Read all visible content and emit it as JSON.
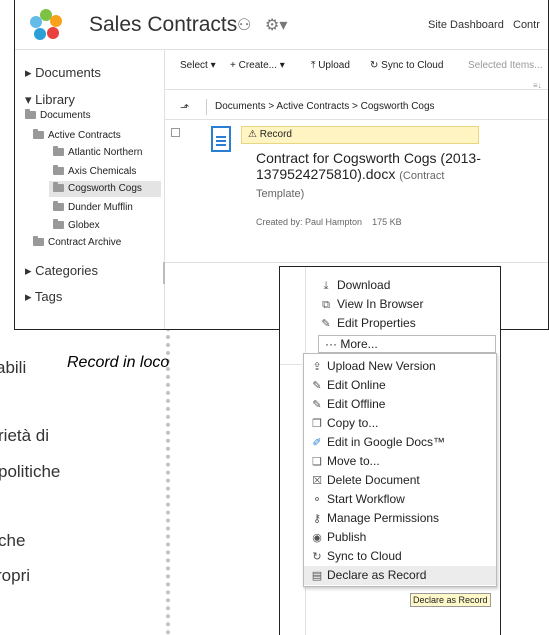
{
  "slide": {
    "caption": "Record in loco",
    "fragments": [
      "abili",
      "rietà di",
      "politiche",
      "che",
      "ropri"
    ]
  },
  "header": {
    "site_title": "Sales Contracts",
    "site_dashboard": "Site Dashboard",
    "contr": "Contr"
  },
  "sidebar": {
    "documents": "Documents",
    "library": "Library",
    "tree": [
      "Documents",
      "Active Contracts",
      "Atlantic Northern",
      "Axis Chemicals",
      "Cogsworth Cogs",
      "Dunder Mufflin",
      "Globex",
      "Contract Archive"
    ],
    "categories": "Categories",
    "tags": "Tags"
  },
  "toolbar": {
    "select": "Select",
    "create": "Create...",
    "upload": "Upload",
    "sync": "Sync to Cloud",
    "selected_items": "Selected Items..."
  },
  "breadcrumb": {
    "text": "Documents > Active Contracts > Cogsworth Cogs"
  },
  "document": {
    "banner": "Record",
    "title": "Contract for Cogsworth Cogs (2013-1379524275810).docx",
    "subtitle": "(Contract Template)",
    "created_by": "Created by: Paul Hampton",
    "size": "175 KB"
  },
  "actions": {
    "download": "Download",
    "view_in_browser": "View In Browser",
    "edit_properties": "Edit Properties",
    "more": "More...",
    "more_items": [
      {
        "label": "Upload New Version",
        "icon": "upload-icon"
      },
      {
        "label": "Edit Online",
        "icon": "pencil-icon"
      },
      {
        "label": "Edit Offline",
        "icon": "pencil-icon"
      },
      {
        "label": "Copy to...",
        "icon": "copy-icon"
      },
      {
        "label": "Edit in Google Docs™",
        "icon": "google-docs-icon"
      },
      {
        "label": "Move to...",
        "icon": "move-icon"
      },
      {
        "label": "Delete Document",
        "icon": "delete-icon"
      },
      {
        "label": "Start Workflow",
        "icon": "workflow-icon"
      },
      {
        "label": "Manage Permissions",
        "icon": "key-icon"
      },
      {
        "label": "Publish",
        "icon": "publish-icon"
      },
      {
        "label": "Sync to Cloud",
        "icon": "sync-icon"
      },
      {
        "label": "Declare as Record",
        "icon": "record-icon"
      }
    ],
    "tooltip": "Declare as Record"
  }
}
